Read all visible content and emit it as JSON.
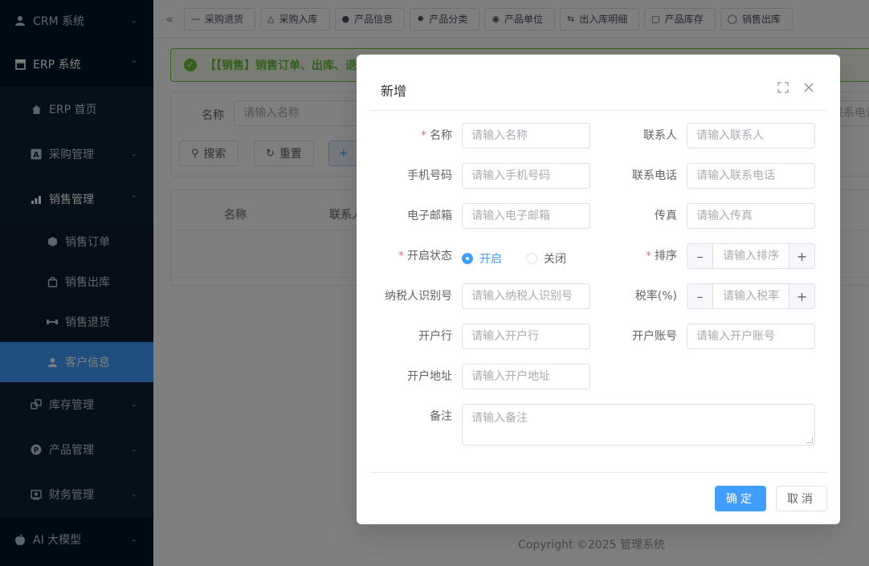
{
  "sidebar": {
    "items": [
      {
        "label": "CRM 系统",
        "icon": "person-icon",
        "arrow": "chevron-down"
      },
      {
        "label": "ERP 系统",
        "icon": "store-icon",
        "arrow": "chevron-up"
      },
      {
        "label": "ERP 首页",
        "icon": "home-icon"
      },
      {
        "label": "采购管理",
        "icon": "a-box-icon",
        "arrow": "chevron-down"
      },
      {
        "label": "销售管理",
        "icon": "chart-icon",
        "arrow": "chevron-up"
      },
      {
        "label": "销售订单",
        "icon": "hexagon-icon"
      },
      {
        "label": "销售出库",
        "icon": "bag-icon"
      },
      {
        "label": "销售退货",
        "icon": "dumbbell-icon"
      },
      {
        "label": "客户信息",
        "icon": "person-icon"
      },
      {
        "label": "库存管理",
        "icon": "boxes-icon",
        "arrow": "chevron-down"
      },
      {
        "label": "产品管理",
        "icon": "p-circle-icon",
        "arrow": "chevron-down"
      },
      {
        "label": "财务管理",
        "icon": "finance-icon",
        "arrow": "chevron-down"
      },
      {
        "label": "AI 大模型",
        "icon": "apple-icon",
        "arrow": "chevron-down"
      }
    ]
  },
  "tags": [
    {
      "label": "采购退货",
      "icon": "minus-icon"
    },
    {
      "label": "采购入库",
      "icon": "road-icon"
    },
    {
      "label": "产品信息",
      "icon": "apple-icon"
    },
    {
      "label": "产品分类",
      "icon": "gear-icon"
    },
    {
      "label": "产品单位",
      "icon": "pin-icon"
    },
    {
      "label": "出入库明细",
      "icon": "swap-icon"
    },
    {
      "label": "产品库存",
      "icon": "cup-icon"
    },
    {
      "label": "销售出库",
      "icon": "bag-icon"
    }
  ],
  "alert": {
    "text": "【【销售】销售订单、出库、退"
  },
  "search": {
    "name_label": "名称",
    "name_placeholder": "请输入名称",
    "right_placeholder": "联系电话",
    "search_label": "搜索",
    "reset_label": "重置",
    "add_label": "+"
  },
  "table": {
    "col_name": "名称",
    "col_contact": "联系人"
  },
  "footer": "Copyright ©2025 管理系统",
  "dialog": {
    "title": "新增",
    "fields": {
      "name": {
        "label": "名称",
        "placeholder": "请输入名称"
      },
      "contact": {
        "label": "联系人",
        "placeholder": "请输入联系人"
      },
      "mobile": {
        "label": "手机号码",
        "placeholder": "请输入手机号码"
      },
      "telephone": {
        "label": "联系电话",
        "placeholder": "请输入联系电话"
      },
      "email": {
        "label": "电子邮箱",
        "placeholder": "请输入电子邮箱"
      },
      "fax": {
        "label": "传真",
        "placeholder": "请输入传真"
      },
      "status": {
        "label": "开启状态",
        "option_on": "开启",
        "option_off": "关闭"
      },
      "sort": {
        "label": "排序",
        "placeholder": "请输入排序"
      },
      "tax_no": {
        "label": "纳税人识别号",
        "placeholder": "请输入纳税人识别号"
      },
      "tax_rate": {
        "label": "税率(%)",
        "placeholder": "请输入税率"
      },
      "bank_name": {
        "label": "开户行",
        "placeholder": "请输入开户行"
      },
      "bank_account": {
        "label": "开户账号",
        "placeholder": "请输入开户账号"
      },
      "bank_address": {
        "label": "开户地址",
        "placeholder": "请输入开户地址"
      },
      "remark": {
        "label": "备注",
        "placeholder": "请输入备注"
      }
    },
    "ok_label": "确定",
    "cancel_label": "取消"
  },
  "colors": {
    "primary": "#409eff",
    "sidebar_bg": "#001529",
    "success": "#67c23a",
    "required": "#f56c6c"
  }
}
